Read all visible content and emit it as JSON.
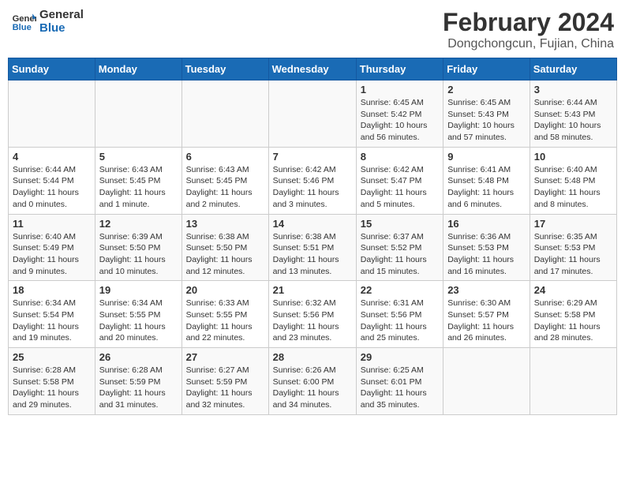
{
  "header": {
    "logo_line1": "General",
    "logo_line2": "Blue",
    "title": "February 2024",
    "subtitle": "Dongchongcun, Fujian, China"
  },
  "days_of_week": [
    "Sunday",
    "Monday",
    "Tuesday",
    "Wednesday",
    "Thursday",
    "Friday",
    "Saturday"
  ],
  "weeks": [
    [
      {
        "num": "",
        "info": ""
      },
      {
        "num": "",
        "info": ""
      },
      {
        "num": "",
        "info": ""
      },
      {
        "num": "",
        "info": ""
      },
      {
        "num": "1",
        "info": "Sunrise: 6:45 AM\nSunset: 5:42 PM\nDaylight: 10 hours and 56 minutes."
      },
      {
        "num": "2",
        "info": "Sunrise: 6:45 AM\nSunset: 5:43 PM\nDaylight: 10 hours and 57 minutes."
      },
      {
        "num": "3",
        "info": "Sunrise: 6:44 AM\nSunset: 5:43 PM\nDaylight: 10 hours and 58 minutes."
      }
    ],
    [
      {
        "num": "4",
        "info": "Sunrise: 6:44 AM\nSunset: 5:44 PM\nDaylight: 11 hours and 0 minutes."
      },
      {
        "num": "5",
        "info": "Sunrise: 6:43 AM\nSunset: 5:45 PM\nDaylight: 11 hours and 1 minute."
      },
      {
        "num": "6",
        "info": "Sunrise: 6:43 AM\nSunset: 5:45 PM\nDaylight: 11 hours and 2 minutes."
      },
      {
        "num": "7",
        "info": "Sunrise: 6:42 AM\nSunset: 5:46 PM\nDaylight: 11 hours and 3 minutes."
      },
      {
        "num": "8",
        "info": "Sunrise: 6:42 AM\nSunset: 5:47 PM\nDaylight: 11 hours and 5 minutes."
      },
      {
        "num": "9",
        "info": "Sunrise: 6:41 AM\nSunset: 5:48 PM\nDaylight: 11 hours and 6 minutes."
      },
      {
        "num": "10",
        "info": "Sunrise: 6:40 AM\nSunset: 5:48 PM\nDaylight: 11 hours and 8 minutes."
      }
    ],
    [
      {
        "num": "11",
        "info": "Sunrise: 6:40 AM\nSunset: 5:49 PM\nDaylight: 11 hours and 9 minutes."
      },
      {
        "num": "12",
        "info": "Sunrise: 6:39 AM\nSunset: 5:50 PM\nDaylight: 11 hours and 10 minutes."
      },
      {
        "num": "13",
        "info": "Sunrise: 6:38 AM\nSunset: 5:50 PM\nDaylight: 11 hours and 12 minutes."
      },
      {
        "num": "14",
        "info": "Sunrise: 6:38 AM\nSunset: 5:51 PM\nDaylight: 11 hours and 13 minutes."
      },
      {
        "num": "15",
        "info": "Sunrise: 6:37 AM\nSunset: 5:52 PM\nDaylight: 11 hours and 15 minutes."
      },
      {
        "num": "16",
        "info": "Sunrise: 6:36 AM\nSunset: 5:53 PM\nDaylight: 11 hours and 16 minutes."
      },
      {
        "num": "17",
        "info": "Sunrise: 6:35 AM\nSunset: 5:53 PM\nDaylight: 11 hours and 17 minutes."
      }
    ],
    [
      {
        "num": "18",
        "info": "Sunrise: 6:34 AM\nSunset: 5:54 PM\nDaylight: 11 hours and 19 minutes."
      },
      {
        "num": "19",
        "info": "Sunrise: 6:34 AM\nSunset: 5:55 PM\nDaylight: 11 hours and 20 minutes."
      },
      {
        "num": "20",
        "info": "Sunrise: 6:33 AM\nSunset: 5:55 PM\nDaylight: 11 hours and 22 minutes."
      },
      {
        "num": "21",
        "info": "Sunrise: 6:32 AM\nSunset: 5:56 PM\nDaylight: 11 hours and 23 minutes."
      },
      {
        "num": "22",
        "info": "Sunrise: 6:31 AM\nSunset: 5:56 PM\nDaylight: 11 hours and 25 minutes."
      },
      {
        "num": "23",
        "info": "Sunrise: 6:30 AM\nSunset: 5:57 PM\nDaylight: 11 hours and 26 minutes."
      },
      {
        "num": "24",
        "info": "Sunrise: 6:29 AM\nSunset: 5:58 PM\nDaylight: 11 hours and 28 minutes."
      }
    ],
    [
      {
        "num": "25",
        "info": "Sunrise: 6:28 AM\nSunset: 5:58 PM\nDaylight: 11 hours and 29 minutes."
      },
      {
        "num": "26",
        "info": "Sunrise: 6:28 AM\nSunset: 5:59 PM\nDaylight: 11 hours and 31 minutes."
      },
      {
        "num": "27",
        "info": "Sunrise: 6:27 AM\nSunset: 5:59 PM\nDaylight: 11 hours and 32 minutes."
      },
      {
        "num": "28",
        "info": "Sunrise: 6:26 AM\nSunset: 6:00 PM\nDaylight: 11 hours and 34 minutes."
      },
      {
        "num": "29",
        "info": "Sunrise: 6:25 AM\nSunset: 6:01 PM\nDaylight: 11 hours and 35 minutes."
      },
      {
        "num": "",
        "info": ""
      },
      {
        "num": "",
        "info": ""
      }
    ]
  ]
}
